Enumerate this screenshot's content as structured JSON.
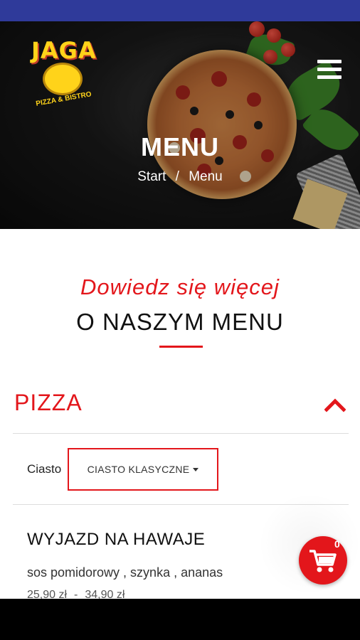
{
  "logo": {
    "text": "JAGA",
    "subtitle": "PIZZA & BISTRO"
  },
  "hero": {
    "title": "MENU",
    "breadcrumb": {
      "home": "Start",
      "separator": "/",
      "current": "Menu"
    }
  },
  "intro": {
    "tagline": "Dowiedz się więcej",
    "heading": "O NASZYM MENU"
  },
  "section": {
    "title": "PIZZA",
    "expanded": true
  },
  "filter": {
    "label": "Ciasto",
    "selected": "CIASTO KLASYCZNE"
  },
  "product": {
    "name": "WYJAZD NA HAWAJE",
    "description": "sos pomidorowy , szynka , ananas",
    "price_small": "25,90 zł",
    "price_separator": "-",
    "price_large": "34,90 zł"
  },
  "cart": {
    "count": "0"
  },
  "colors": {
    "accent": "#e3161b",
    "status_bar": "#2f3a9a",
    "logo_yellow": "#ffd31a"
  },
  "icons": {
    "menu": "hamburger-icon",
    "collapse": "chevron-up-icon",
    "cart": "cart-icon"
  }
}
